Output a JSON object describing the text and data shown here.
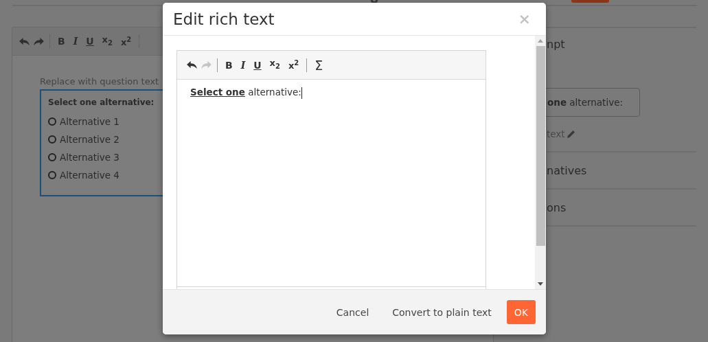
{
  "question_editor": {
    "toolbar": [
      {
        "kind": "undo",
        "disabled": false
      },
      {
        "kind": "redo",
        "disabled": false
      },
      {
        "kind": "separator"
      },
      {
        "kind": "bold",
        "label": "B",
        "disabled": false
      },
      {
        "kind": "italic",
        "label": "I",
        "disabled": false
      },
      {
        "kind": "underline",
        "label": "U",
        "disabled": false
      },
      {
        "kind": "subscript",
        "label": "x$_{2}$",
        "disabled": false
      },
      {
        "kind": "superscript",
        "label": "x$^{2}$",
        "disabled": false
      },
      {
        "kind": "separator"
      }
    ],
    "placeholder": "Replace with question text",
    "preview": {
      "title": "Select one alternative:",
      "alternatives": [
        {
          "label": "Alternative 1",
          "selected": false
        },
        {
          "label": "Alternative 2",
          "selected": false
        },
        {
          "label": "Alternative 3",
          "selected": false
        },
        {
          "label": "Alternative 4",
          "selected": false
        }
      ]
    }
  },
  "side_panel": {
    "sections": [
      {
        "kind": "heading",
        "label": "npt"
      },
      {
        "kind": "field",
        "value": "**one** alternative:"
      },
      {
        "kind": "edit_link",
        "label": "text"
      },
      {
        "kind": "heading",
        "label": "natives"
      },
      {
        "kind": "heading",
        "label": "ons"
      }
    ]
  },
  "dialog": {
    "title": "Edit rich text",
    "close": "×",
    "toolbar": [
      {
        "kind": "undo",
        "disabled": false
      },
      {
        "kind": "redo",
        "disabled": true
      },
      {
        "kind": "separator"
      },
      {
        "kind": "bold",
        "label": "B",
        "disabled": false
      },
      {
        "kind": "italic",
        "label": "I",
        "disabled": false
      },
      {
        "kind": "underline",
        "label": "U",
        "disabled": false
      },
      {
        "kind": "subscript",
        "label": "x$_{2}$",
        "disabled": false
      },
      {
        "kind": "superscript",
        "label": "x$^{2}$",
        "disabled": false
      },
      {
        "kind": "separator"
      },
      {
        "kind": "sum",
        "label": "Σ",
        "disabled": false
      }
    ],
    "content": "**Select one** alternative:",
    "buttons": [
      {
        "kind": "link",
        "label": "Cancel"
      },
      {
        "kind": "link",
        "label": "Convert to plain text"
      },
      {
        "kind": "primary",
        "label": "OK"
      }
    ]
  }
}
